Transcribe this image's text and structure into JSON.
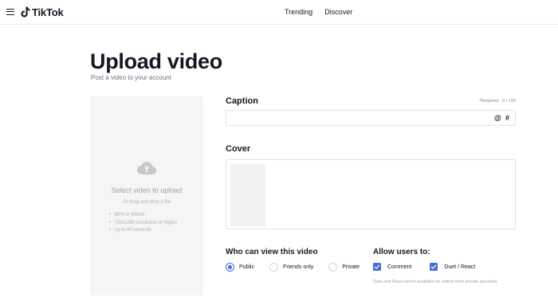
{
  "header": {
    "logo_text": "TikTok",
    "nav": [
      "Trending",
      "Discover"
    ]
  },
  "page": {
    "title": "Upload video",
    "subtitle": "Post a video to your account"
  },
  "upload": {
    "title": "Select video to upload",
    "drag_text": "Or drag and drop a file",
    "requirements": [
      "MP4 or WebM",
      "720x1280 resolution or higher",
      "Up to 60 seconds"
    ]
  },
  "caption": {
    "label": "Caption",
    "required_text": "*Required",
    "counter": "0 / 100",
    "value": "",
    "placeholder": "",
    "at_symbol": "@",
    "hash_symbol": "#"
  },
  "cover": {
    "label": "Cover"
  },
  "visibility": {
    "label": "Who can view this video",
    "options": [
      {
        "label": "Public",
        "checked": true
      },
      {
        "label": "Friends only",
        "checked": false
      },
      {
        "label": "Private",
        "checked": false
      }
    ]
  },
  "allow": {
    "label": "Allow users to:",
    "options": [
      {
        "label": "Comment",
        "checked": true
      },
      {
        "label": "Duet / React",
        "checked": true
      }
    ],
    "note": "Duet and React aren't available on videos from private accounts."
  },
  "colors": {
    "accent": "#4b6bd6",
    "text": "#161823",
    "muted": "#a1a1a6",
    "upload_bg": "#f5f5f5"
  }
}
